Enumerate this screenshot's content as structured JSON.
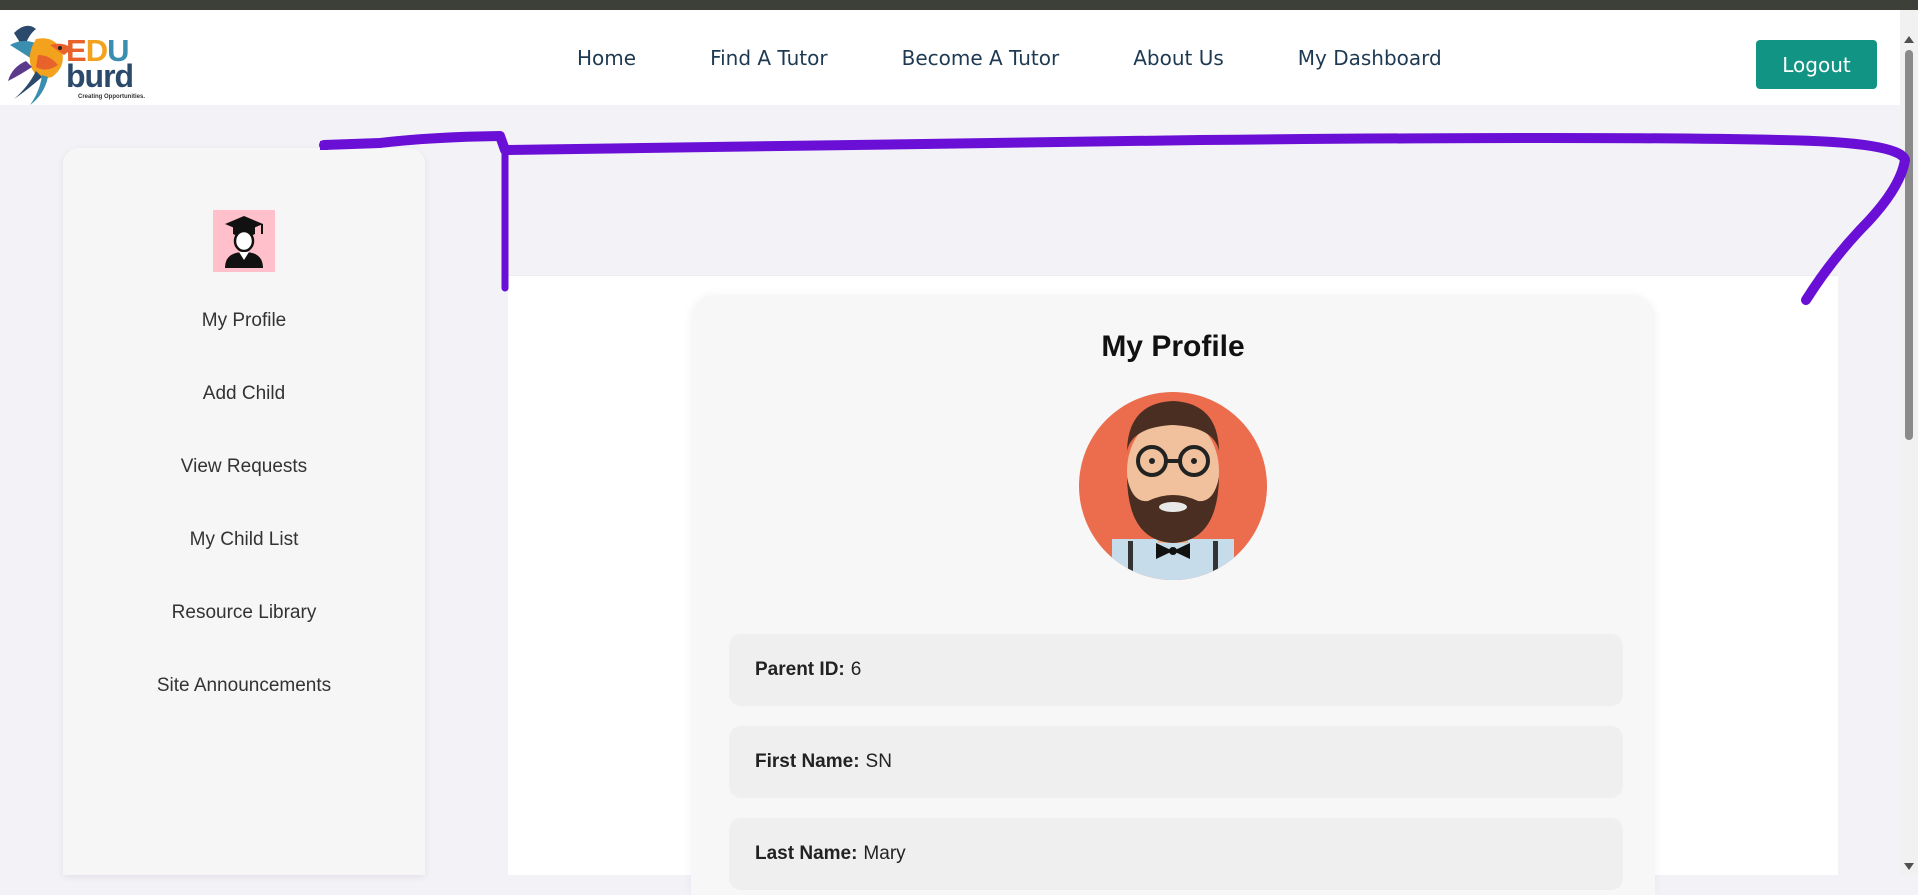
{
  "brand": {
    "edu_e": "E",
    "edu_d": "D",
    "edu_u": "U",
    "burd": "burd",
    "tagline": "Creating Opportunities."
  },
  "nav": {
    "links": [
      "Home",
      "Find A Tutor",
      "Become A Tutor",
      "About Us",
      "My Dashboard"
    ],
    "logout_label": "Logout"
  },
  "sidebar": {
    "items": [
      "My Profile",
      "Add Child",
      "View Requests",
      "My Child List",
      "Resource Library",
      "Site Announcements"
    ]
  },
  "profile": {
    "title": "My Profile",
    "fields": [
      {
        "label": "Parent ID:",
        "value": "6"
      },
      {
        "label": "First Name:",
        "value": "SN"
      },
      {
        "label": "Last Name:",
        "value": "Mary"
      }
    ]
  },
  "colors": {
    "accent": "#129484",
    "annotation": "#6a0fd6",
    "nav_text": "#1e3a52"
  },
  "icons": {
    "logo": "bird-logo",
    "sidebar_avatar": "graduate-icon",
    "profile_avatar": "bearded-man-avatar"
  }
}
